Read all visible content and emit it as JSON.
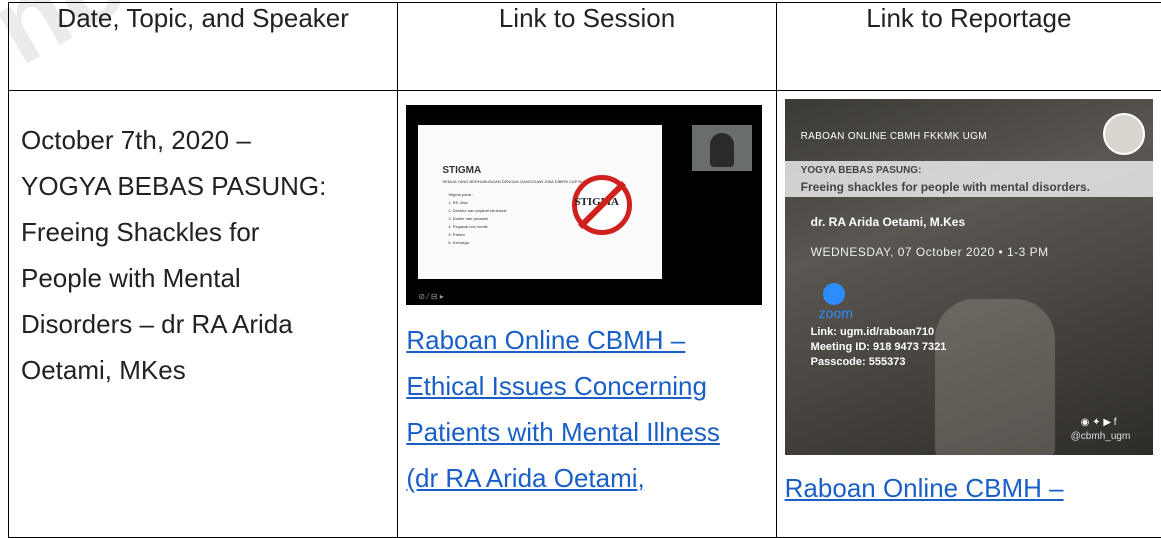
{
  "watermark": "neso",
  "table": {
    "headers": [
      "Date, Topic, and Speaker",
      "Link to Session",
      "Link to Reportage"
    ],
    "row": {
      "topic_lines": [
        "October 7th, 2020 –",
        "YOGYA BEBAS PASUNG:",
        "Freeing Shackles for",
        "People with Mental",
        "Disorders – dr RA Arida",
        "Oetami, MKes"
      ],
      "session": {
        "thumbnail": {
          "slide_title": "STIGMA",
          "slide_subtitle": "SEMUA YANG BERHUBUNGAN DENGAN GANGGUAN JIWA DIBERI CAP BURUK",
          "slide_list_title": "Stigma pada :",
          "slide_items": [
            "1. RS Jiwa",
            "2. Direktur dan pejabat struktural",
            "3. Dokter dan perawat",
            "4. Pegawai non medis",
            "5. Pasien",
            "6. Keluarga"
          ],
          "stop_sign_text": "STIGMA"
        },
        "link_lines": [
          "Raboan Online CBMH –",
          "Ethical Issues Concerning",
          "Patients with Mental Illness",
          "(dr RA Arida Oetami,"
        ]
      },
      "reportage": {
        "poster": {
          "header": "RABOAN ONLINE CBMH FKKMK UGM",
          "title1": "YOGYA BEBAS PASUNG:",
          "title2": "Freeing shackles for people with mental disorders.",
          "speaker": "dr. RA Arida Oetami, M.Kes",
          "date": "WEDNESDAY, 07 October 2020 • 1-3 PM",
          "zoom": "zoom",
          "link": "Link: ugm.id/raboan710",
          "meeting_id": "Meeting ID: 918 9473 7321",
          "passcode": "Passcode: 555373",
          "handle": "@cbmh_ugm"
        },
        "link_lines": [
          "Raboan Online CBMH –"
        ]
      }
    }
  },
  "colors": {
    "link": "#1a5fc8",
    "border": "#000000",
    "no_sign": "#d0201e",
    "zoom": "#2d8cff"
  }
}
